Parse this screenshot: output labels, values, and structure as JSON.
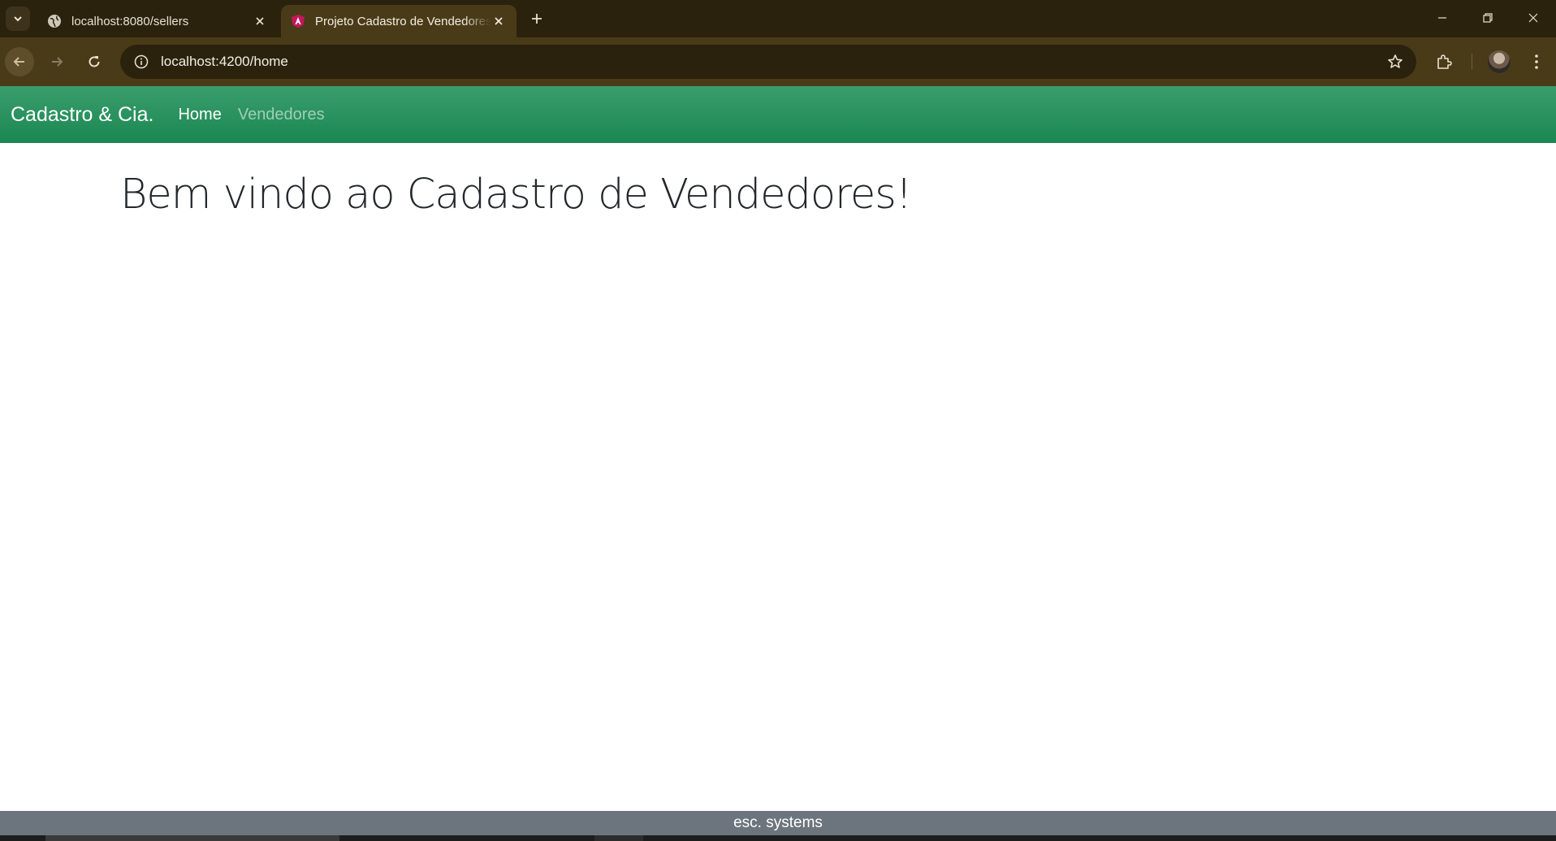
{
  "browser": {
    "tabs": [
      {
        "title": "localhost:8080/sellers",
        "active": false,
        "favicon": "globe-icon"
      },
      {
        "title": "Projeto Cadastro de Vendedores",
        "active": true,
        "favicon": "angular-icon"
      }
    ],
    "address_bar": {
      "url": "localhost:4200/home"
    }
  },
  "app": {
    "brand": "Cadastro & Cia.",
    "nav": [
      {
        "label": "Home",
        "active": true
      },
      {
        "label": "Vendedores",
        "active": false
      }
    ],
    "welcome": "Bem vindo ao Cadastro de Vendedores!",
    "footer": "esc. systems"
  },
  "colors": {
    "navbar": "#1b8753",
    "footer": "#6c757d",
    "chrome": "#2b220e"
  }
}
